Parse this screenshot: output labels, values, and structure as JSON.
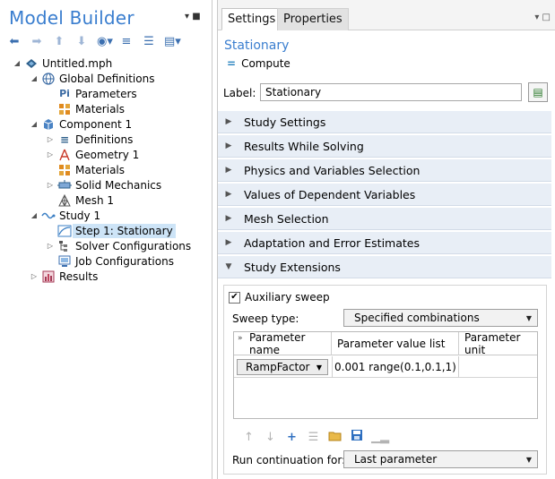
{
  "model_builder": {
    "title": "Model Builder",
    "title_menu_icons": [
      "pin-icon",
      "menu-icon"
    ],
    "toolbar": [
      "back-arrow-icon",
      "forward-arrow-icon",
      "move-up-icon",
      "move-down-icon",
      "show-icon",
      "expand-all-icon",
      "collapse-all-icon",
      "layout-icon"
    ],
    "tree": {
      "root": "Untitled.mph",
      "global_definitions": "Global Definitions",
      "parameters": "Parameters",
      "materials_global": "Materials",
      "component": "Component 1",
      "definitions": "Definitions",
      "geometry": "Geometry 1",
      "materials": "Materials",
      "solid_mechanics": "Solid Mechanics",
      "mesh": "Mesh 1",
      "study": "Study 1",
      "step": "Step 1: Stationary",
      "solver_configs": "Solver Configurations",
      "job_configs": "Job Configurations",
      "results": "Results"
    }
  },
  "settings": {
    "tabs": [
      "Settings",
      "Properties"
    ],
    "node_title": "Stationary",
    "compute_label": "Compute",
    "label_caption": "Label:",
    "label_value": "Stationary",
    "sections": [
      "Study Settings",
      "Results While Solving",
      "Physics and Variables Selection",
      "Values of Dependent Variables",
      "Mesh Selection",
      "Adaptation and Error Estimates",
      "Study Extensions"
    ],
    "study_extensions": {
      "auxiliary_sweep_label": "Auxiliary sweep",
      "auxiliary_sweep_checked": true,
      "sweep_type_label": "Sweep type:",
      "sweep_type_value": "Specified combinations",
      "table_headers": [
        "Parameter name",
        "Parameter value list",
        "Parameter unit"
      ],
      "rows": [
        {
          "name": "RampFactor",
          "values": "0.001 range(0.1,0.1,1)",
          "unit": ""
        }
      ],
      "table_toolbar": [
        "move-up-icon",
        "move-down-icon",
        "add-icon",
        "delete-icon",
        "open-folder-icon",
        "save-icon",
        "range-icon"
      ],
      "run_continuation_label": "Run continuation for:",
      "run_continuation_value": "Last parameter"
    }
  },
  "colors": {
    "title_blue": "#3a7ecf",
    "section_bg": "#e8eef6",
    "selection_bg": "#cde4f7"
  }
}
